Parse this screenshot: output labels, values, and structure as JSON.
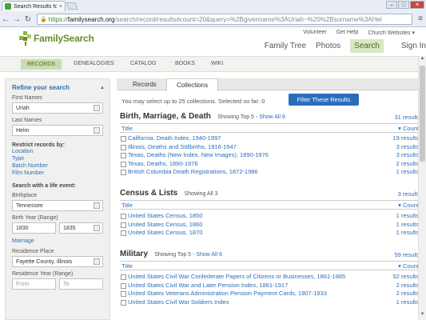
{
  "browser": {
    "tab_title": "Search Results for Uriah",
    "url_scheme": "https://",
    "url_host": "familysearch.org",
    "url_path": "/search/record/results#count=20&query=%2Bgivenname%3AUriah~%20%2Bsurname%3AHel"
  },
  "header": {
    "logo": "FamilySearch",
    "utils": [
      "Volunteer",
      "Get Help",
      "Church Websites ▾"
    ],
    "nav": [
      "Family Tree",
      "Photos",
      "Search"
    ],
    "sign_in": "Sign In"
  },
  "subnav": [
    "RECORDS",
    "GENEALOGIES",
    "CATALOG",
    "BOOKS",
    "WIKI"
  ],
  "refine": {
    "title": "Refine your search",
    "first_names_label": "First Names",
    "first_names_value": "Uriah",
    "last_names_label": "Last Names",
    "last_names_value": "Helm",
    "restrict_title": "Restrict records by:",
    "restrict_links": [
      "Location",
      "Type",
      "Batch Number",
      "Film Number"
    ],
    "life_event_title": "Search with a life event:",
    "birthplace_label": "Birthplace",
    "birthplace_value": "Tennessee",
    "birth_year_label": "Birth Year (Range)",
    "birth_year_from": "1830",
    "birth_year_to": "1835",
    "marriage_link": "Marriage",
    "residence_place_label": "Residence Place",
    "residence_place_value": "Fayette County, Illinois",
    "residence_year_label": "Residence Year (Range)",
    "residence_from_placeholder": "From",
    "residence_to_placeholder": "To"
  },
  "results": {
    "tabs": [
      "Records",
      "Collections"
    ],
    "select_info": "You may select up to 25 collections. Selected so far: 0",
    "filter_button": "Filter These Results",
    "col_title": "Title",
    "col_count": "Count",
    "groups": [
      {
        "title": "Birth, Marriage, & Death",
        "showing": "Showing Top 5 -",
        "show_all": "Show All 8",
        "count": "31 results",
        "items": [
          {
            "name": "California, Death Index, 1940-1997",
            "count": "19 results"
          },
          {
            "name": "Illinois, Deaths and Stillbirths, 1916-1947",
            "count": "3 results"
          },
          {
            "name": "Texas, Deaths (New Index, New Images), 1890-1976",
            "count": "3 results"
          },
          {
            "name": "Texas, Deaths, 1890-1976",
            "count": "2 results"
          },
          {
            "name": "British Columbia Death Registrations, 1872-1986",
            "count": "1 results"
          }
        ]
      },
      {
        "title": "Census & Lists",
        "showing": "Showing All 3",
        "show_all": "",
        "count": "3 results",
        "items": [
          {
            "name": "United States Census, 1850",
            "count": "1 results"
          },
          {
            "name": "United States Census, 1860",
            "count": "1 results"
          },
          {
            "name": "United States Census, 1870",
            "count": "1 results"
          }
        ]
      },
      {
        "title": "Military",
        "showing": "Showing Top 5 -",
        "show_all": "Show All 6",
        "count": "59 results",
        "items": [
          {
            "name": "United States Civil War Confederate Papers of Citizens or Businesses, 1861-1865",
            "count": "52 results"
          },
          {
            "name": "United States Civil War and Later Pension Index, 1861-1917",
            "count": "2 results"
          },
          {
            "name": "United States Veterans Administration Pension Payment Cards, 1907-1933",
            "count": "2 results"
          },
          {
            "name": "United States Civil War Soldiers Index",
            "count": "1 results"
          }
        ]
      }
    ]
  }
}
